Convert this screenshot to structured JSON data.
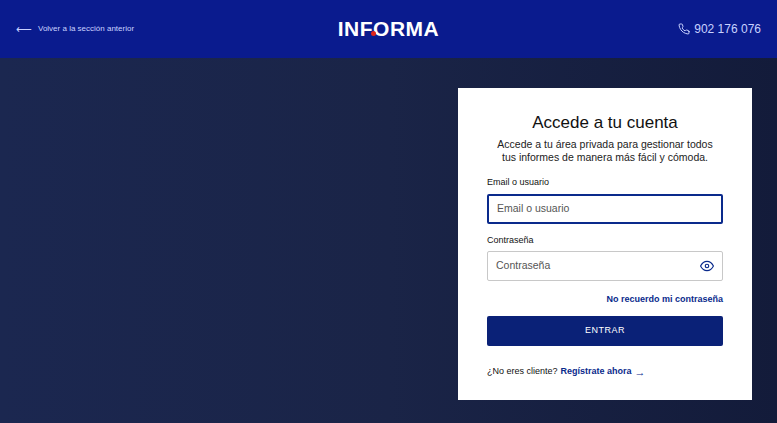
{
  "header": {
    "back_arrow": "⟵",
    "back_link": "Volver a la sección anterior",
    "logo": "INFORMA",
    "phone": "902 176 076"
  },
  "login": {
    "title": "Accede a tu cuenta",
    "subtitle": "Accede a tu área privada para gestionar todos tus informes de manera más fácil y cómoda.",
    "fields": [
      {
        "label": "Email o usuario",
        "placeholder": "Email o usuario",
        "focused": true,
        "kind": "text"
      },
      {
        "label": "Contraseña",
        "placeholder": "Contraseña",
        "focused": false,
        "kind": "password"
      }
    ],
    "forgot_link": "No recuerdo mi contraseña",
    "submit_button": "ENTRAR",
    "signup_prompt": "¿No eres cliente?",
    "signup_link": "Regístrate ahora",
    "signup_arrow": "→"
  }
}
